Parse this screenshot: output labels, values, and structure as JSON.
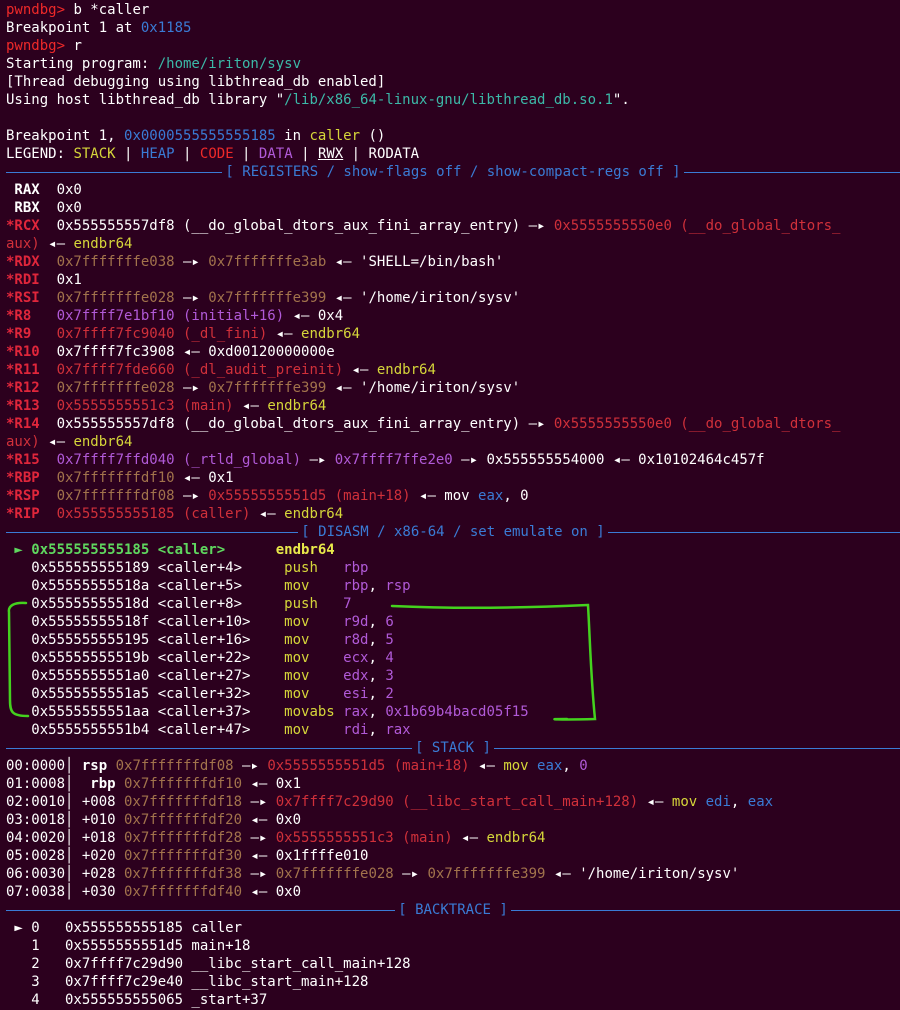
{
  "pre": [
    [
      [
        "red",
        "pwndbg> "
      ],
      [
        "dim",
        "b *caller"
      ]
    ],
    [
      [
        "dim",
        "Breakpoint 1 at "
      ],
      [
        "blue",
        "0x1185"
      ]
    ],
    [
      [
        "red",
        "pwndbg> "
      ],
      [
        "dim",
        "r"
      ]
    ],
    [
      [
        "dim",
        "Starting program: "
      ],
      [
        "teal",
        "/home/iriton/sysv"
      ]
    ],
    [
      [
        "dim",
        "[Thread debugging using libthread_db enabled]"
      ]
    ],
    [
      [
        "dim",
        "Using host libthread_db library \""
      ],
      [
        "teal",
        "/lib/x86_64-linux-gnu/libthread_db.so.1"
      ],
      [
        "dim",
        "\"."
      ]
    ],
    [
      [
        "dim",
        ""
      ]
    ],
    [
      [
        "dim",
        "Breakpoint 1, "
      ],
      [
        "blue",
        "0x0000555555555185"
      ],
      [
        "dim",
        " in "
      ],
      [
        "yellow",
        "caller"
      ],
      [
        "dim",
        " ()"
      ]
    ],
    [
      [
        "dim",
        "LEGEND: "
      ],
      [
        "yellow",
        "STACK"
      ],
      [
        "dim",
        " | "
      ],
      [
        "blue",
        "HEAP"
      ],
      [
        "dim",
        " | "
      ],
      [
        "red",
        "CODE"
      ],
      [
        "dim",
        " | "
      ],
      [
        "purple",
        "DATA"
      ],
      [
        "dim",
        " | "
      ],
      [
        "u",
        "RWX"
      ],
      [
        "dim",
        " | RODATA"
      ]
    ]
  ],
  "sections": {
    "registers": "[ REGISTERS / show-flags off / show-compact-regs off ]",
    "disasm": "[ DISASM / x86-64 / set emulate on ]",
    "stack": "[ STACK ]",
    "backtrace": "[ BACKTRACE ]"
  },
  "registers": [
    [
      [
        "wb",
        " RAX"
      ],
      [
        "dim",
        "  0x0"
      ]
    ],
    [
      [
        "wb",
        " RBX"
      ],
      [
        "dim",
        "  0x0"
      ]
    ],
    [
      [
        "reg",
        "*RCX"
      ],
      [
        "dim",
        "  0x555555557df8 (__do_global_dtors_aux_fini_array_entry) —▸ "
      ],
      [
        "rd2",
        "0x5555555550e0 (__do_global_dtors_"
      ]
    ],
    [
      [
        "rd2",
        "aux)"
      ],
      [
        "dim",
        " ◂— "
      ],
      [
        "yellow",
        "endbr64"
      ]
    ],
    [
      [
        "reg",
        "*RDX"
      ],
      [
        "brown",
        "  0x7fffffffe038"
      ],
      [
        "dim",
        " —▸ "
      ],
      [
        "brown",
        "0x7fffffffe3ab"
      ],
      [
        "dim",
        " ◂— 'SHELL=/bin/bash'"
      ]
    ],
    [
      [
        "reg",
        "*RDI"
      ],
      [
        "dim",
        "  0x1"
      ]
    ],
    [
      [
        "reg",
        "*RSI"
      ],
      [
        "brown",
        "  0x7fffffffe028"
      ],
      [
        "dim",
        " —▸ "
      ],
      [
        "brown",
        "0x7fffffffe399"
      ],
      [
        "dim",
        " ◂— '/home/iriton/sysv'"
      ]
    ],
    [
      [
        "reg",
        "*R8 "
      ],
      [
        "purple",
        "  0x7ffff7e1bf10 (initial+16)"
      ],
      [
        "dim",
        " ◂— 0x4"
      ]
    ],
    [
      [
        "reg",
        "*R9 "
      ],
      [
        "rd2",
        "  0x7ffff7fc9040 (_dl_fini)"
      ],
      [
        "dim",
        " ◂— "
      ],
      [
        "yellow",
        "endbr64"
      ]
    ],
    [
      [
        "reg",
        "*R10"
      ],
      [
        "dim",
        "  0x7ffff7fc3908 ◂— 0xd00120000000e"
      ]
    ],
    [
      [
        "reg",
        "*R11"
      ],
      [
        "rd2",
        "  0x7ffff7fde660 (_dl_audit_preinit)"
      ],
      [
        "dim",
        " ◂— "
      ],
      [
        "yellow",
        "endbr64"
      ]
    ],
    [
      [
        "reg",
        "*R12"
      ],
      [
        "brown",
        "  0x7fffffffe028"
      ],
      [
        "dim",
        " —▸ "
      ],
      [
        "brown",
        "0x7fffffffe399"
      ],
      [
        "dim",
        " ◂— '/home/iriton/sysv'"
      ]
    ],
    [
      [
        "reg",
        "*R13"
      ],
      [
        "rd2",
        "  0x5555555551c3 (main)"
      ],
      [
        "dim",
        " ◂— "
      ],
      [
        "yellow",
        "endbr64"
      ]
    ],
    [
      [
        "reg",
        "*R14"
      ],
      [
        "dim",
        "  0x555555557df8 (__do_global_dtors_aux_fini_array_entry) —▸ "
      ],
      [
        "rd2",
        "0x5555555550e0 (__do_global_dtors_"
      ]
    ],
    [
      [
        "rd2",
        "aux)"
      ],
      [
        "dim",
        " ◂— "
      ],
      [
        "yellow",
        "endbr64"
      ]
    ],
    [
      [
        "reg",
        "*R15"
      ],
      [
        "purple",
        "  0x7ffff7ffd040 (_rtld_global)"
      ],
      [
        "dim",
        " —▸ "
      ],
      [
        "purple",
        "0x7ffff7ffe2e0"
      ],
      [
        "dim",
        " —▸ 0x555555554000 ◂— 0x10102464c457f"
      ]
    ],
    [
      [
        "reg",
        "*RBP"
      ],
      [
        "brown",
        "  0x7fffffffdf10"
      ],
      [
        "dim",
        " ◂— 0x1"
      ]
    ],
    [
      [
        "reg",
        "*RSP"
      ],
      [
        "brown",
        "  0x7fffffffdf08"
      ],
      [
        "dim",
        " —▸ "
      ],
      [
        "rd2",
        "0x5555555551d5 (main+18)"
      ],
      [
        "dim",
        " ◂— mov "
      ],
      [
        "blue",
        "eax"
      ],
      [
        "dim",
        ", 0"
      ]
    ],
    [
      [
        "reg",
        "*RIP"
      ],
      [
        "rd2",
        "  0x555555555185 (caller)"
      ],
      [
        "dim",
        " ◂— "
      ],
      [
        "yellow",
        "endbr64"
      ]
    ]
  ],
  "disasm": [
    [
      [
        "gb",
        " ► 0x555555555185 <caller>      "
      ],
      [
        "yb",
        "endbr64"
      ]
    ],
    [
      [
        "dim",
        "   0x555555555189 <caller+4>     "
      ],
      [
        "yellow",
        "push   "
      ],
      [
        "purple",
        "rbp"
      ]
    ],
    [
      [
        "dim",
        "   0x55555555518a <caller+5>     "
      ],
      [
        "yellow",
        "mov    "
      ],
      [
        "purple",
        "rbp"
      ],
      [
        "dim",
        ", "
      ],
      [
        "purple",
        "rsp"
      ]
    ],
    [
      [
        "dim",
        "   0x55555555518d <caller+8>     "
      ],
      [
        "yellow",
        "push   "
      ],
      [
        "purple",
        "7"
      ]
    ],
    [
      [
        "dim",
        "   0x55555555518f <caller+10>    "
      ],
      [
        "yellow",
        "mov    "
      ],
      [
        "purple",
        "r9d"
      ],
      [
        "dim",
        ", "
      ],
      [
        "purple",
        "6"
      ]
    ],
    [
      [
        "dim",
        "   0x555555555195 <caller+16>    "
      ],
      [
        "yellow",
        "mov    "
      ],
      [
        "purple",
        "r8d"
      ],
      [
        "dim",
        ", "
      ],
      [
        "purple",
        "5"
      ]
    ],
    [
      [
        "dim",
        "   0x55555555519b <caller+22>    "
      ],
      [
        "yellow",
        "mov    "
      ],
      [
        "purple",
        "ecx"
      ],
      [
        "dim",
        ", "
      ],
      [
        "purple",
        "4"
      ]
    ],
    [
      [
        "dim",
        "   0x5555555551a0 <caller+27>    "
      ],
      [
        "yellow",
        "mov    "
      ],
      [
        "purple",
        "edx"
      ],
      [
        "dim",
        ", "
      ],
      [
        "purple",
        "3"
      ]
    ],
    [
      [
        "dim",
        "   0x5555555551a5 <caller+32>    "
      ],
      [
        "yellow",
        "mov    "
      ],
      [
        "purple",
        "esi"
      ],
      [
        "dim",
        ", "
      ],
      [
        "purple",
        "2"
      ]
    ],
    [
      [
        "dim",
        "   0x5555555551aa <caller+37>    "
      ],
      [
        "yellow",
        "movabs "
      ],
      [
        "purple",
        "rax"
      ],
      [
        "dim",
        ", "
      ],
      [
        "purple",
        "0x1b69b4bacd05f15"
      ]
    ],
    [
      [
        "dim",
        "   0x5555555551b4 <caller+47>    "
      ],
      [
        "yellow",
        "mov    "
      ],
      [
        "purple",
        "rdi"
      ],
      [
        "dim",
        ", "
      ],
      [
        "purple",
        "rax"
      ]
    ]
  ],
  "stack": [
    [
      [
        "dim",
        "00:0000│ "
      ],
      [
        "wb",
        "rsp"
      ],
      [
        "brown",
        " 0x7fffffffdf08"
      ],
      [
        "dim",
        " —▸ "
      ],
      [
        "rd2",
        "0x5555555551d5 (main+18)"
      ],
      [
        "dim",
        " ◂— "
      ],
      [
        "yellow",
        "mov "
      ],
      [
        "blue",
        "eax"
      ],
      [
        "dim",
        ", "
      ],
      [
        "purple",
        "0"
      ]
    ],
    [
      [
        "dim",
        "01:0008│  "
      ],
      [
        "wb",
        "rbp"
      ],
      [
        "brown",
        " 0x7fffffffdf10"
      ],
      [
        "dim",
        " ◂— 0x1"
      ]
    ],
    [
      [
        "dim",
        "02:0010│ +008"
      ],
      [
        "brown",
        " 0x7fffffffdf18"
      ],
      [
        "dim",
        " —▸ "
      ],
      [
        "rd2",
        "0x7ffff7c29d90 (__libc_start_call_main+128)"
      ],
      [
        "dim",
        " ◂— "
      ],
      [
        "yellow",
        "mov "
      ],
      [
        "blue",
        "edi"
      ],
      [
        "dim",
        ", "
      ],
      [
        "blue",
        "eax"
      ]
    ],
    [
      [
        "dim",
        "03:0018│ +010"
      ],
      [
        "brown",
        " 0x7fffffffdf20"
      ],
      [
        "dim",
        " ◂— 0x0"
      ]
    ],
    [
      [
        "dim",
        "04:0020│ +018"
      ],
      [
        "brown",
        " 0x7fffffffdf28"
      ],
      [
        "dim",
        " —▸ "
      ],
      [
        "rd2",
        "0x5555555551c3 (main)"
      ],
      [
        "dim",
        " ◂— "
      ],
      [
        "yellow",
        "endbr64"
      ]
    ],
    [
      [
        "dim",
        "05:0028│ +020"
      ],
      [
        "brown",
        " 0x7fffffffdf30"
      ],
      [
        "dim",
        " ◂— 0x1ffffe010"
      ]
    ],
    [
      [
        "dim",
        "06:0030│ +028"
      ],
      [
        "brown",
        " 0x7fffffffdf38"
      ],
      [
        "dim",
        " —▸ "
      ],
      [
        "brown",
        "0x7fffffffe028"
      ],
      [
        "dim",
        " —▸ "
      ],
      [
        "brown",
        "0x7fffffffe399"
      ],
      [
        "dim",
        " ◂— '/home/iriton/sysv'"
      ]
    ],
    [
      [
        "dim",
        "07:0038│ +030"
      ],
      [
        "brown",
        " 0x7fffffffdf40"
      ],
      [
        "dim",
        " ◂— 0x0"
      ]
    ]
  ],
  "backtrace": [
    [
      [
        "dim",
        " ► 0   0x555555555185 caller"
      ]
    ],
    [
      [
        "dim",
        "   1   0x5555555551d5 main+18"
      ]
    ],
    [
      [
        "dim",
        "   2   0x7ffff7c29d90 __libc_start_call_main+128"
      ]
    ],
    [
      [
        "dim",
        "   3   0x7ffff7c29e40 __libc_start_main+128"
      ]
    ],
    [
      [
        "dim",
        "   4   0x555555555065 _start+37"
      ]
    ]
  ],
  "colors": {
    "background": "#2c001e",
    "annotation": "#44d21e"
  }
}
